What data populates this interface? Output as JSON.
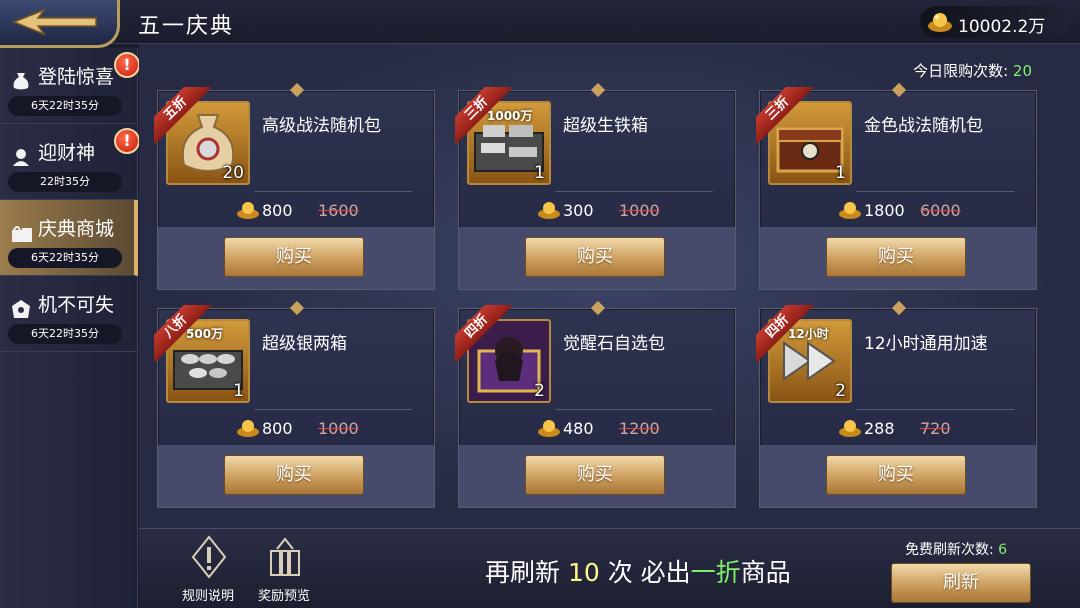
{
  "header": {
    "title": "五一庆典",
    "currency": "10002.2万"
  },
  "sidebar": {
    "items": [
      {
        "label": "登陆惊喜",
        "timer": "6天22时35分",
        "alert": "!"
      },
      {
        "label": "迎财神",
        "timer": "22时35分",
        "alert": "!"
      },
      {
        "label": "庆典商城",
        "timer": "6天22时35分"
      },
      {
        "label": "机不可失",
        "timer": "6天22时35分"
      }
    ]
  },
  "shop": {
    "limit_label": "今日限购次数:",
    "limit_value": "20",
    "items": [
      {
        "discount": "五折",
        "name": "高级战法随机包",
        "qty": "20",
        "qty_label": "",
        "price": "800",
        "old_price": "1600",
        "buy": "购买"
      },
      {
        "discount": "三折",
        "name": "超级生铁箱",
        "qty": "1",
        "qty_label": "1000万",
        "price": "300",
        "old_price": "1000",
        "buy": "购买"
      },
      {
        "discount": "三折",
        "name": "金色战法随机包",
        "qty": "1",
        "qty_label": "",
        "price": "1800",
        "old_price": "6000",
        "buy": "购买"
      },
      {
        "discount": "八折",
        "name": "超级银两箱",
        "qty": "1",
        "qty_label": "500万",
        "price": "800",
        "old_price": "1000",
        "buy": "购买"
      },
      {
        "discount": "四折",
        "name": "觉醒石自选包",
        "qty": "2",
        "qty_label": "",
        "price": "480",
        "old_price": "1200",
        "buy": "购买"
      },
      {
        "discount": "四折",
        "name": "12小时通用加速",
        "qty": "2",
        "qty_label": "12小时",
        "price": "288",
        "old_price": "720",
        "buy": "购买"
      }
    ]
  },
  "bottom": {
    "rules": "规则说明",
    "rewards": "奖励预览",
    "promo_a": "再刷新 ",
    "promo_count": "10",
    "promo_b": " 次 必出",
    "promo_highlight": "一折",
    "promo_c": "商品",
    "free_label": "免费刷新次数:",
    "free_value": "6",
    "refresh": "刷新"
  }
}
